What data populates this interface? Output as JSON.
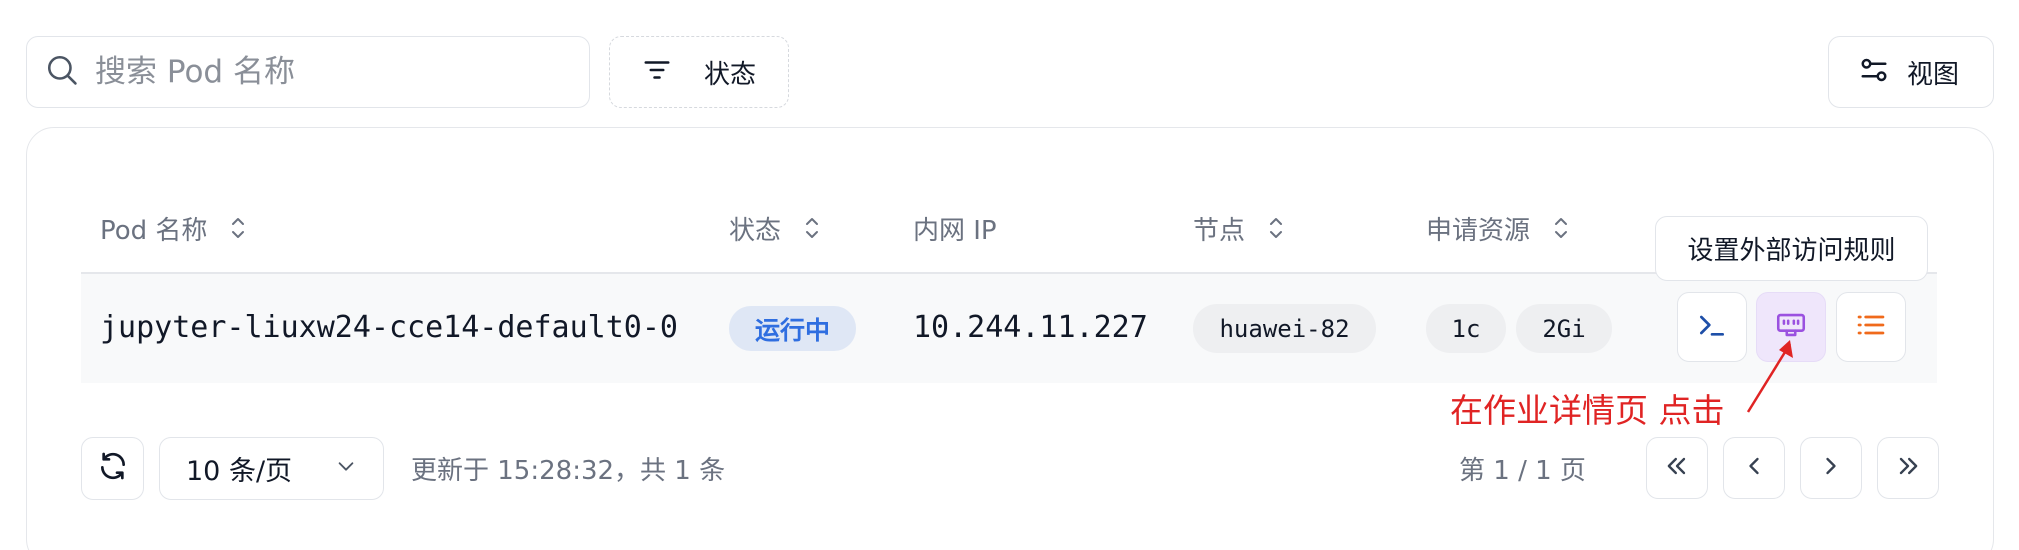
{
  "toolbar": {
    "search_placeholder": "搜索 Pod 名称",
    "status_filter_label": "状态",
    "view_label": "视图"
  },
  "table": {
    "columns": [
      "Pod 名称",
      "状态",
      "内网 IP",
      "节点",
      "申请资源"
    ],
    "rows": [
      {
        "pod_name": "jupyter-liuxw24-cce14-default0-0",
        "status": "运行中",
        "ip": "10.244.11.227",
        "node": "huawei-82",
        "cpu": "1c",
        "memory": "2Gi"
      }
    ],
    "tooltip": "设置外部访问规则"
  },
  "annotation": "在作业详情页 点击",
  "footer": {
    "page_size": "10 条/页",
    "update_info": "更新于 15:28:32，共 1 条",
    "page_info": "第 1 / 1 页"
  },
  "colors": {
    "status_running_bg": "#dfe7f5",
    "status_running_text": "#2f6ee0",
    "annotation_red": "#e02424",
    "terminal_icon": "#1e4fa8",
    "network_icon": "#9b51e0",
    "list_icon": "#f06a1b"
  }
}
